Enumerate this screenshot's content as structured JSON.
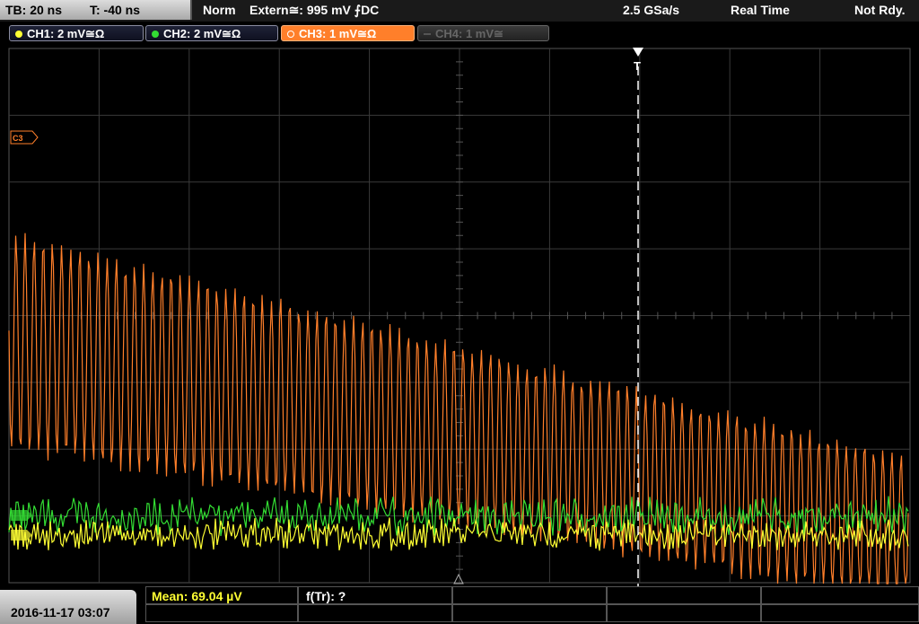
{
  "topbar": {
    "timebase": "TB: 20 ns",
    "trigger_time": "T: -40 ns",
    "mode": "Norm",
    "trigger_source": "Extern≅: 995 mV ⨍DC",
    "sample_rate": "2.5 GSa/s",
    "acq_mode": "Real Time",
    "status": "Not Rdy."
  },
  "channels": [
    {
      "label": "CH1: 2 mV≅Ω",
      "color": "#ffff33",
      "state": "on"
    },
    {
      "label": "CH2: 2 mV≅Ω",
      "color": "#33dd33",
      "state": "on"
    },
    {
      "label": "CH3: 1 mV≅Ω",
      "color": "#ff7f2a",
      "state": "active"
    },
    {
      "label": "CH4: 1 mV≅",
      "color": "#555555",
      "state": "off"
    }
  ],
  "scope": {
    "marker_ch3": "C3",
    "trigger_marker": "T",
    "colors": {
      "ch1": "#ffff33",
      "ch2": "#33dd33",
      "ch3": "#ff7f2a",
      "grid": "#444444"
    }
  },
  "bottom": {
    "datetime": "2016-11-17 03:07",
    "mean_label": "Mean: 69.04 µV",
    "freq_label": "f(Tr): ?"
  }
}
